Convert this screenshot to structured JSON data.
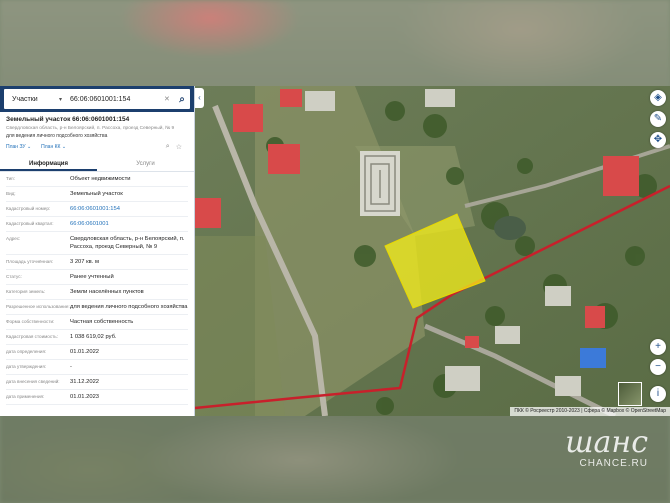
{
  "search": {
    "type_label": "Участки",
    "query": "66:06:0601001:154"
  },
  "card": {
    "title": "Земельный участок 66:06:0601001:154",
    "address_line": "Свердловская область, р-н Белоярский, п. Рассоха, проезд Северный, № 9",
    "use_line": "для ведения личного подсобного хозяйства",
    "link_1": "План ЗУ ⌄",
    "link_2": "План КК ⌄"
  },
  "tabs": {
    "info": "Информация",
    "services": "Услуги"
  },
  "rows": [
    {
      "key": "Тип:",
      "value": "Объект недвижимости"
    },
    {
      "key": "Вид:",
      "value": "Земельный участок"
    },
    {
      "key": "Кадастровый номер:",
      "value": "66:06:0601001:154"
    },
    {
      "key": "Кадастровый квартал:",
      "value": "66:06:0601001"
    },
    {
      "key": "Адрес:",
      "value": "Свердловская область, р-н Белоярский, п. Рассоха, проезд Северный, № 9"
    },
    {
      "key": "Площадь уточнённая:",
      "value": "3 207 кв. м"
    },
    {
      "key": "Статус:",
      "value": "Ранее учтенный"
    },
    {
      "key": "Категория земель:",
      "value": "Земли населённых пунктов"
    },
    {
      "key": "Разрешенное использование:",
      "value": "для ведения личного подсобного хозяйства"
    },
    {
      "key": "Форма собственности:",
      "value": "Частная собственность"
    },
    {
      "key": "Кадастровая стоимость:",
      "value": "1 038 619,02 руб."
    },
    {
      "key": "дата определения:",
      "value": "01.01.2022"
    },
    {
      "key": "дата утверждения:",
      "value": "-"
    },
    {
      "key": "дата внесения сведений:",
      "value": "31.12.2022"
    },
    {
      "key": "дата применения:",
      "value": "01.01.2023"
    }
  ],
  "map": {
    "attribution": "ПКК © Росреестр 2010-2023 | Сфера © Mapbox © OpenStreetMap",
    "controls": {
      "layers": "layers-icon",
      "ruler": "ruler-icon",
      "move": "move-icon",
      "zoom_in": "+",
      "zoom_out": "−",
      "info": "info-icon"
    },
    "parcel_color": "#f5ef1a",
    "boundary_color": "#c8202b"
  },
  "watermark": {
    "logo": "шанс",
    "site": "CHANCE.RU"
  }
}
